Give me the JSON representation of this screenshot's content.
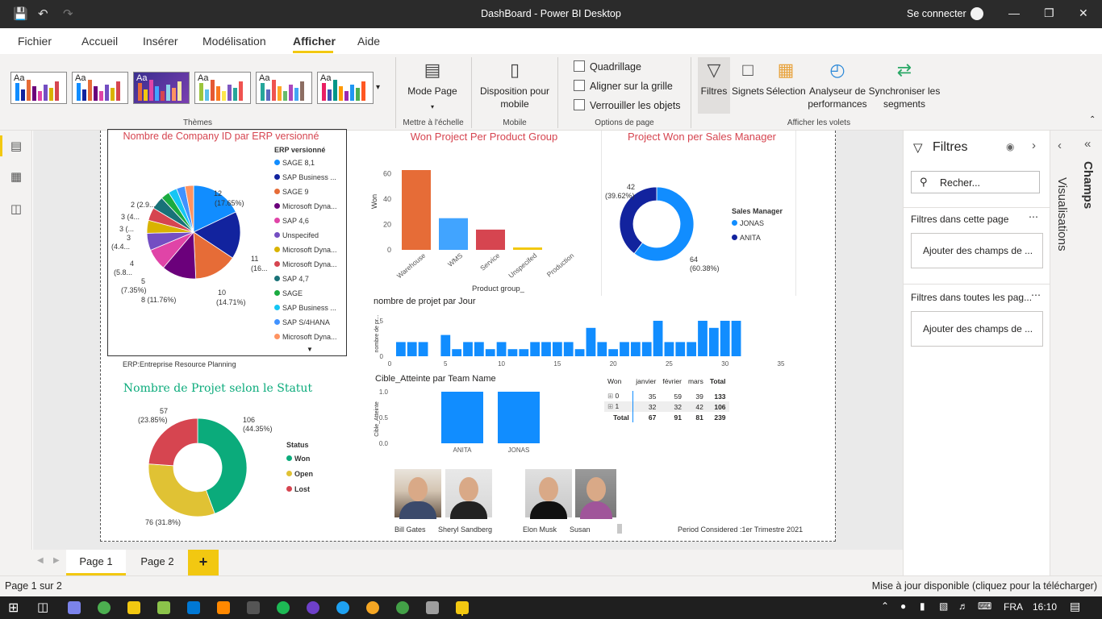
{
  "window": {
    "title": "DashBoard - Power BI Desktop",
    "signin": "Se connecter"
  },
  "menu": [
    "Fichier",
    "Accueil",
    "Insérer",
    "Modélisation",
    "Afficher",
    "Aide"
  ],
  "ribbon": {
    "theme_label": "Aa",
    "groups": {
      "themes": "Thèmes",
      "scale": "Mettre à l'échelle",
      "mobile": "Mobile",
      "page_options": "Options de page",
      "panes": "Afficher les volets"
    },
    "mode_page": "Mode Page",
    "mobile_layout": "Disposition pour mobile",
    "checkboxes": [
      "Quadrillage",
      "Aligner sur la grille",
      "Verrouiller les objets"
    ],
    "panes_buttons": [
      "Filtres",
      "Signets",
      "Sélection",
      "Analyseur de performances",
      "Synchroniser les segments"
    ]
  },
  "pie1": {
    "title": "Nombre de Company ID par ERP versionné",
    "legend_title": "ERP versionné",
    "legend": [
      "SAGE 8,1",
      "SAP Business ...",
      "SAGE 9",
      "Microsoft Dyna...",
      "SAP 4,6",
      "Unspecifed",
      "Microsoft Dyna...",
      "Microsoft Dyna...",
      "SAP 4,7",
      "SAGE",
      "SAP Business ...",
      "SAP S/4HANA",
      "Microsoft Dyna..."
    ],
    "labels": {
      "a": "12",
      "a2": "(17.65%)",
      "b": "11",
      "b2": "(16...",
      "c": "10",
      "c2": "(14.71%)",
      "d": "8 (11.76%)",
      "e": "5",
      "e2": "(7.35%)",
      "f": "4",
      "f2": "(5.8...",
      "g": "3",
      "g2": "(4.4...",
      "h": "3 (...",
      "i": "3 (4...",
      "j": "2 (2.9..."
    },
    "footer": "ERP:Entreprise Resource Planning"
  },
  "bar1": {
    "title": "Won Project Per Product Group",
    "ylabel": "Won",
    "xlabel": "Product group_"
  },
  "donut1": {
    "title": "Project Won per Sales Manager",
    "legend_title": "Sales Manager",
    "legend": [
      "JONAS",
      "ANITA"
    ],
    "l1": "42",
    "l1b": "(39.62%)",
    "l2": "64",
    "l2b": "(60.38%)"
  },
  "col1": {
    "title": "nombre de projet par Jour",
    "ylabel": "nombre de pr..."
  },
  "donut2": {
    "title": "Nombre de Projet selon le Statut",
    "legend_title": "Status",
    "legend": [
      "Won",
      "Open",
      "Lost"
    ],
    "l1": "57",
    "l1b": "(23.85%)",
    "l2": "106",
    "l2b": "(44.35%)",
    "l3": "76 (31.8%)"
  },
  "bar2": {
    "title": "Cible_Atteinte par Team Name",
    "ylabel": "Cible_Atteinte"
  },
  "matrix": {
    "headers": [
      "Won",
      "janvier",
      "février",
      "mars",
      "Total"
    ],
    "rows": [
      [
        "0",
        "35",
        "59",
        "39",
        "133"
      ],
      [
        "1",
        "32",
        "32",
        "42",
        "106"
      ],
      [
        "Total",
        "67",
        "91",
        "81",
        "239"
      ]
    ]
  },
  "people": [
    "Bill Gates",
    "Sheryl Sandberg",
    "Elon Musk",
    "Susan"
  ],
  "period": "Period Considered :1er Trimestre 2021",
  "filters": {
    "title": "Filtres",
    "search": "Recher...",
    "this_page": "Filtres dans cette page",
    "all_pages": "Filtres dans toutes les pag...",
    "add": "Ajouter des champs de ..."
  },
  "side_tabs": {
    "vis": "Visualisations",
    "fields": "Champs"
  },
  "pages": [
    "Page 1",
    "Page 2"
  ],
  "status": {
    "left": "Page 1 sur 2",
    "right": "Mise à jour disponible (cliquez pour la télécharger)"
  },
  "taskbar": {
    "lang": "FRA",
    "time": "16:10"
  },
  "chart_data": [
    {
      "type": "pie",
      "title": "Nombre de Company ID par ERP versionné",
      "categories": [
        "SAGE 8,1",
        "SAP Business ...",
        "SAGE 9",
        "Microsoft Dyna...",
        "SAP 4,6",
        "Unspecifed",
        "Microsoft Dyna...",
        "Microsoft Dyna...",
        "SAP 4,7",
        "SAGE",
        "SAP Business ...",
        "SAP S/4HANA",
        "Microsoft Dyna..."
      ],
      "values": [
        12,
        11,
        10,
        8,
        5,
        4,
        3,
        3,
        3,
        2,
        2,
        2,
        2
      ],
      "colors": [
        "#118dff",
        "#12239e",
        "#e66c37",
        "#6b007b",
        "#e044a7",
        "#744ec2",
        "#d9b300",
        "#d64550",
        "#197278",
        "#1aab40",
        "#15c6f4",
        "#4092ff",
        "#ff9361"
      ]
    },
    {
      "type": "bar",
      "title": "Won Project Per Product Group",
      "xlabel": "Product group_",
      "ylabel": "Won",
      "categories": [
        "Warehouse",
        "WMS",
        "Service",
        "Unspecifed",
        "Production"
      ],
      "values": [
        63,
        25,
        16,
        1,
        0
      ],
      "ylim": [
        0,
        70
      ],
      "yticks": [
        0,
        20,
        40,
        60
      ],
      "colors": [
        "#e66c37",
        "#41a4ff",
        "#d64550",
        "#f2c811",
        "#e044a7"
      ]
    },
    {
      "type": "pie",
      "title": "Project Won per Sales Manager",
      "categories": [
        "JONAS",
        "ANITA"
      ],
      "values": [
        64,
        42
      ],
      "colors": [
        "#118dff",
        "#12239e"
      ]
    },
    {
      "type": "bar",
      "title": "nombre de projet par Jour",
      "x": [
        1,
        2,
        3,
        5,
        6,
        7,
        8,
        9,
        10,
        11,
        12,
        13,
        14,
        15,
        16,
        17,
        18,
        19,
        20,
        21,
        22,
        23,
        24,
        25,
        26,
        27,
        28,
        29,
        30,
        31
      ],
      "values": [
        2,
        2,
        2,
        3,
        1,
        2,
        2,
        1,
        2,
        1,
        1,
        2,
        2,
        2,
        2,
        1,
        4,
        2,
        1,
        2,
        2,
        2,
        5,
        2,
        2,
        2,
        5,
        4,
        5,
        5
      ],
      "xlim": [
        0,
        35
      ],
      "xticks": [
        0,
        5,
        10,
        15,
        20,
        25,
        30,
        35
      ],
      "ylim": [
        0,
        5
      ],
      "yticks": [
        0,
        5
      ],
      "color": "#118dff"
    },
    {
      "type": "pie",
      "title": "Nombre de Projet selon le Statut",
      "categories": [
        "Won",
        "Open",
        "Lost"
      ],
      "values": [
        106,
        76,
        57
      ],
      "colors": [
        "#0bab7b",
        "#e0c234",
        "#d64550"
      ]
    },
    {
      "type": "bar",
      "title": "Cible_Atteinte par Team Name",
      "ylabel": "Cible_Atteinte",
      "categories": [
        "ANITA",
        "JONAS"
      ],
      "values": [
        1.0,
        1.0
      ],
      "ylim": [
        0,
        1.0
      ],
      "yticks": [
        0.0,
        0.5,
        1.0
      ],
      "color": "#118dff"
    }
  ]
}
